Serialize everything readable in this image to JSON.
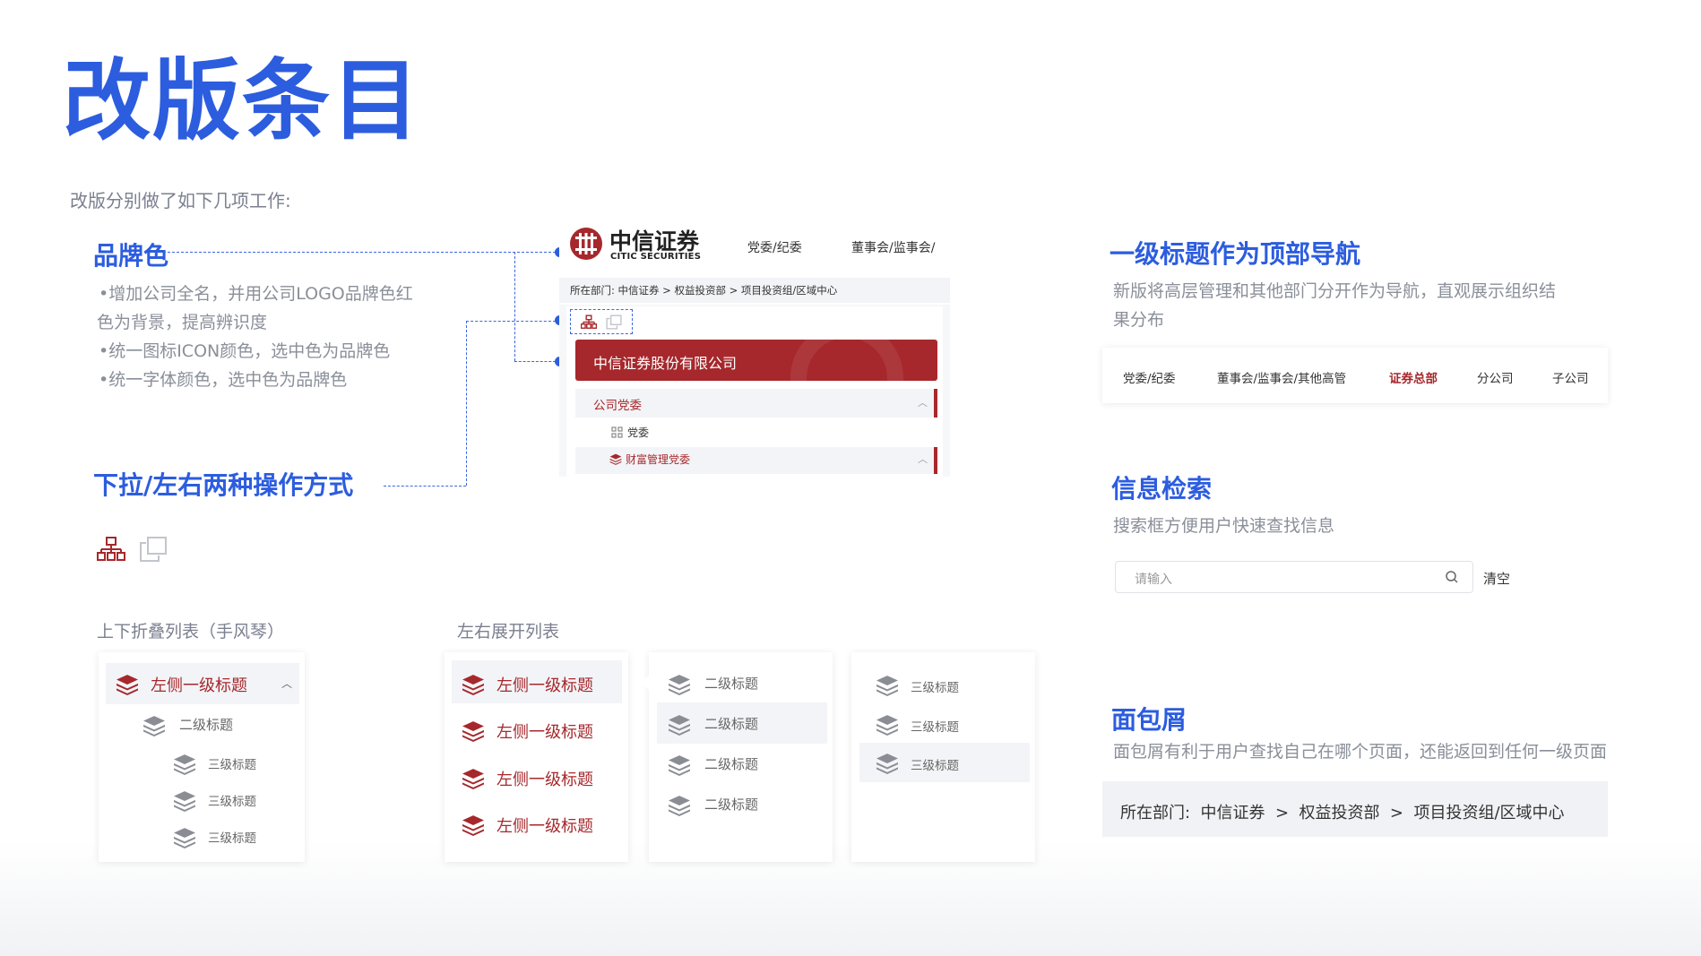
{
  "page": {
    "title": "改版条目",
    "subtitle": "改版分别做了如下几项工作:"
  },
  "brand": {
    "heading": "品牌色",
    "bullets": [
      "•增加公司全名，并用公司LOGO品牌色红",
      "色为背景，提高辨识度",
      "•统一图标ICON颜色，选中色为品牌色",
      "•统一字体颜色，选中色为品牌色"
    ]
  },
  "mode": {
    "heading": "下拉/左右两种操作方式"
  },
  "preview": {
    "logo_cn": "中信证券",
    "logo_en": "CITIC SECURITIES",
    "nav": [
      "党委/纪委",
      "董事会/监事会/"
    ],
    "breadcrumb": "所在部门:  中信证券 > 权益投资部 > 项目投资组/区域中心",
    "company": "中信证券股份有限公司",
    "group1": "公司党委",
    "item1": "党委",
    "group2": "财富管理党委"
  },
  "accordion": {
    "caption": "上下折叠列表（手风琴）",
    "level1": "左侧一级标题",
    "level2": "二级标题",
    "level3": [
      "三级标题",
      "三级标题",
      "三级标题"
    ]
  },
  "lr": {
    "caption": "左右展开列表",
    "col1": [
      "左侧一级标题",
      "左侧一级标题",
      "左侧一级标题",
      "左侧一级标题"
    ],
    "col2": [
      "二级标题",
      "二级标题",
      "二级标题",
      "二级标题"
    ],
    "col3": [
      "三级标题",
      "三级标题",
      "三级标题"
    ]
  },
  "topnav": {
    "heading": "一级标题作为顶部导航",
    "desc1": "新版将高层管理和其他部门分开作为导航，直观展示组织结",
    "desc2": "果分布",
    "items": [
      "党委/纪委",
      "董事会/监事会/其他高管",
      "证券总部",
      "分公司",
      "子公司"
    ],
    "active_index": 2
  },
  "search": {
    "heading": "信息检索",
    "desc": "搜索框方便用户快速查找信息",
    "placeholder": "请输入",
    "clear": "清空"
  },
  "crumb": {
    "heading": "面包屑",
    "desc": "面包屑有利于用户查找自己在哪个页面，还能返回到任何一级页面",
    "path": "所在部门:  中信证券  >  权益投资部  >  项目投资组/区域中心"
  },
  "colors": {
    "brand_red": "#a6282c",
    "accent_blue": "#2c5ddf"
  }
}
